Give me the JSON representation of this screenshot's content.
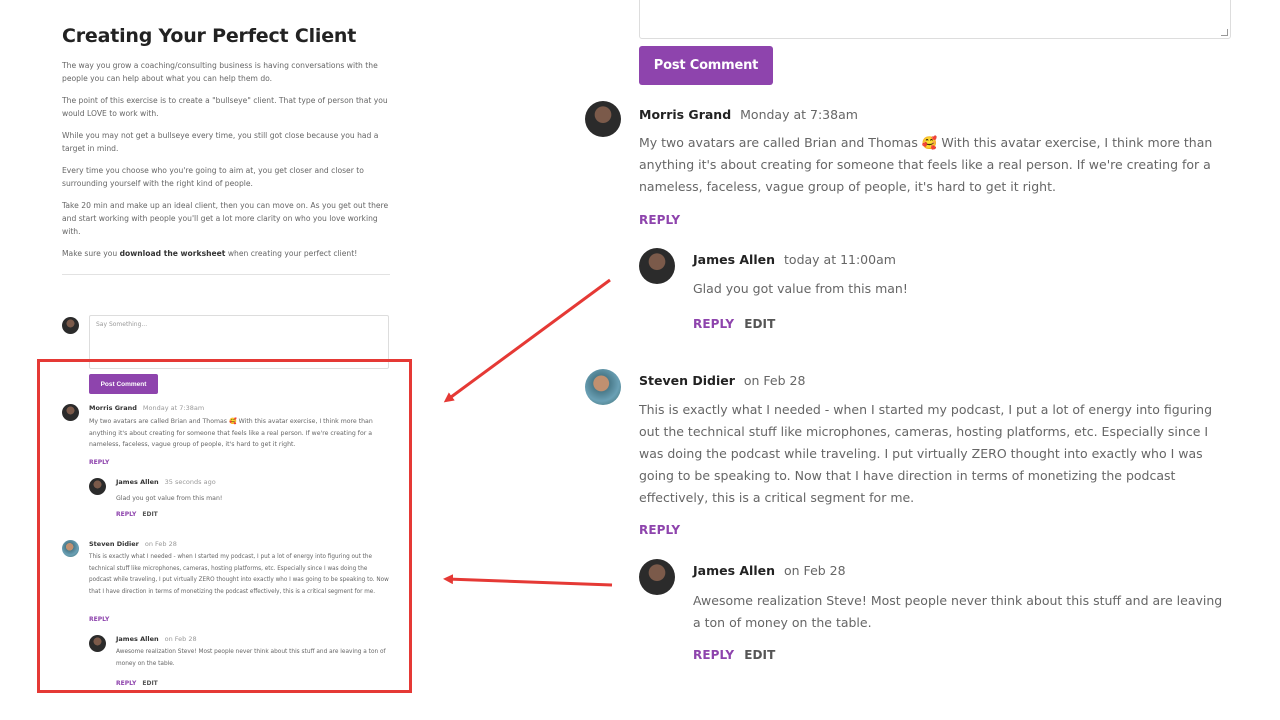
{
  "article": {
    "title": "Creating Your Perfect Client",
    "paragraphs": [
      "The way you grow a coaching/consulting business is having conversations with the people you can help about what you can help them do.",
      "The point of this exercise is to create a \"bullseye\" client. That type of person that you would LOVE to work with.",
      "While you may not get a bullseye every time, you still got close because you had a target in mind.",
      "Every time you choose who you're going to aim at, you get closer and closer to surrounding yourself with the right kind of people.",
      "Take 20 min and make up an ideal client, then you can move on. As you get out there and start working with people you'll get a lot more clarity on who you love working with."
    ],
    "closing_prefix": "Make sure you ",
    "closing_bold": "download the worksheet",
    "closing_suffix": " when creating your perfect client!"
  },
  "comment_form": {
    "placeholder": "Say Something...",
    "submit_label": "Post Comment"
  },
  "labels": {
    "reply": "REPLY",
    "edit": "EDIT"
  },
  "comments_small": [
    {
      "author": "Morris Grand",
      "date": "Monday at 7:38am",
      "text": "My two avatars are called Brian and Thomas 🥰 With this avatar exercise, I think more than anything it's about creating for someone that feels like a real person. If we're creating for a nameless, faceless, vague group of people, it's hard to get it right."
    },
    {
      "author": "James Allen",
      "date": "35 seconds ago",
      "text": "Glad you got value from this man!"
    },
    {
      "author": "Steven Didier",
      "date": "on Feb 28",
      "text": "This is exactly what I needed - when I started my podcast, I put a lot of energy into figuring out the technical stuff like microphones, cameras, hosting platforms, etc. Especially since I was doing the podcast while traveling, I put virtually ZERO thought into exactly who I was going to be speaking to. Now that I have direction in terms of monetizing the podcast effectively, this is a critical segment for me."
    },
    {
      "author": "James Allen",
      "date": "on Feb 28",
      "text": "Awesome realization Steve! Most people never think about this stuff and are leaving a ton of money on the table."
    }
  ],
  "comments_large": [
    {
      "author": "Morris Grand",
      "date": "Monday at 7:38am",
      "text": "My two avatars are called Brian and Thomas 🥰 With this avatar exercise, I think more than anything it's about creating for someone that feels like a real person. If we're creating for a nameless, faceless, vague group of people, it's hard to get it right."
    },
    {
      "author": "James Allen",
      "date": "today at 11:00am",
      "text": "Glad you got value from this man!"
    },
    {
      "author": "Steven Didier",
      "date": "on Feb 28",
      "text": "This is exactly what I needed - when I started my podcast, I put a lot of energy into figuring out the technical stuff like microphones, cameras, hosting platforms, etc. Especially since I was doing the podcast while traveling. I put virtually ZERO thought into exactly who I was going to be speaking to. Now that I have direction in terms of monetizing the podcast effectively, this is a critical segment for me."
    },
    {
      "author": "James Allen",
      "date": "on Feb 28",
      "text": "Awesome realization Steve! Most people never think about this stuff and are leaving a ton of money on the table."
    }
  ],
  "colors": {
    "accent": "#8e44ad",
    "highlight": "#e53935"
  }
}
